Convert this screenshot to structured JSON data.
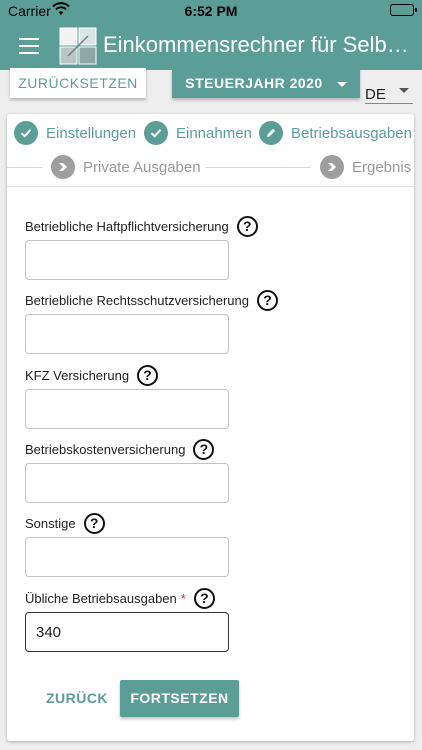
{
  "status_bar": {
    "carrier": "Carrier",
    "time": "6:52 PM"
  },
  "app_bar": {
    "title": "Einkommensrechner für Selbständige",
    "menu_icon": "menu-icon",
    "logo_icon": "app-logo-icon"
  },
  "toolbar": {
    "reset_label": "ZURÜCKSETZEN",
    "tax_year_label": "STEUERJAHR 2020",
    "language_value": "DE"
  },
  "stepper": {
    "steps": [
      {
        "label": "Einstellungen",
        "state": "done",
        "icon": "check-icon"
      },
      {
        "label": "Einnahmen",
        "state": "done",
        "icon": "check-icon"
      },
      {
        "label": "Betriebsausgaben",
        "state": "active",
        "icon": "pencil-icon"
      },
      {
        "label": "Private Ausgaben",
        "state": "pending",
        "icon": "chevron-right-icon"
      },
      {
        "label": "Ergebnis",
        "state": "pending",
        "icon": "chevron-right-icon"
      }
    ]
  },
  "form": {
    "fields": [
      {
        "label": "Betriebliche Haftpflichtversicherung",
        "value": "",
        "required": false
      },
      {
        "label": "Betriebliche Rechtsschutzversicherung",
        "value": "",
        "required": false
      },
      {
        "label": "KFZ Versicherung",
        "value": "",
        "required": false
      },
      {
        "label": "Betriebskostenversicherung",
        "value": "",
        "required": false
      },
      {
        "label": "Sonstige",
        "value": "",
        "required": false
      },
      {
        "label": "Übliche Betriebsausgaben",
        "value": "340",
        "required": true
      }
    ],
    "required_marker": "*",
    "help_glyph": "?"
  },
  "actions": {
    "back_label": "ZURÜCK",
    "next_label": "FORTSETZEN"
  },
  "colors": {
    "primary": "#5b9e98",
    "inactive": "#9e9e9e",
    "required": "#d32f2f"
  }
}
